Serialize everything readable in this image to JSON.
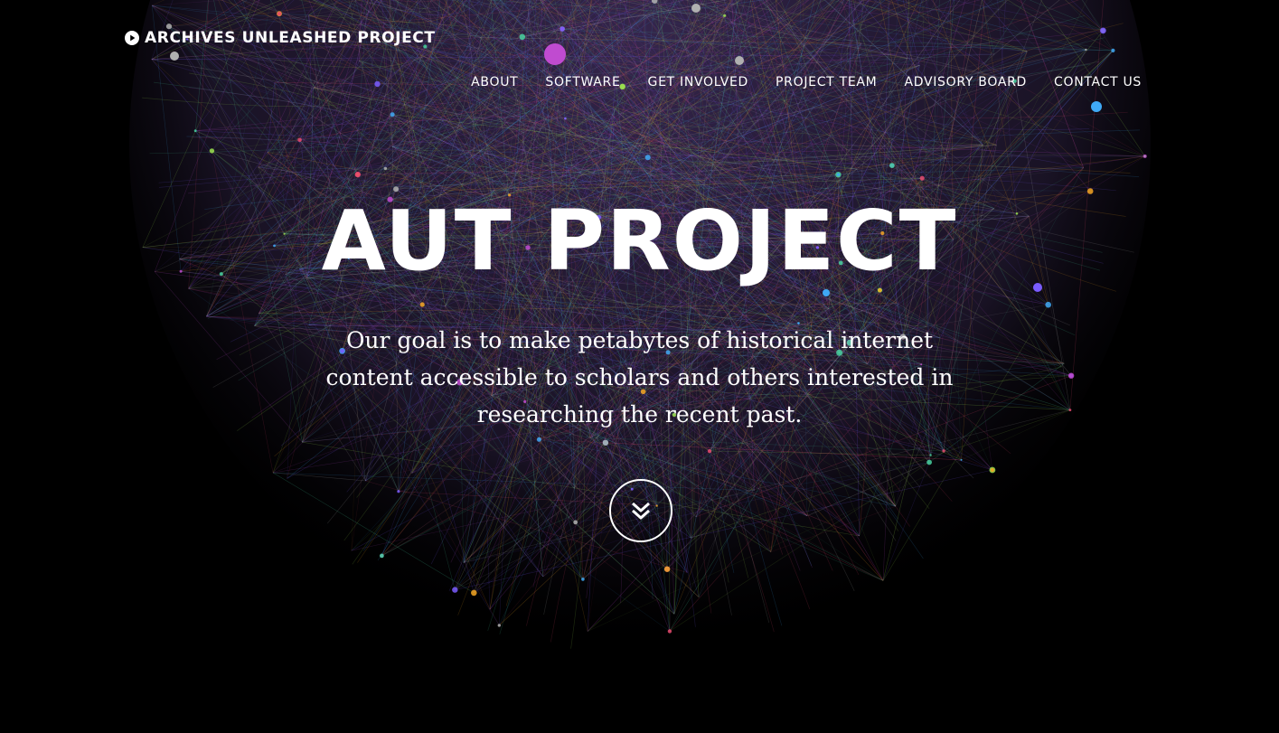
{
  "brand": {
    "title": "ARCHIVES UNLEASHED PROJECT",
    "icon": "play-circle-icon"
  },
  "nav": {
    "items": [
      {
        "label": "ABOUT"
      },
      {
        "label": "SOFTWARE"
      },
      {
        "label": "GET INVOLVED"
      },
      {
        "label": "PROJECT TEAM"
      },
      {
        "label": "ADVISORY BOARD"
      },
      {
        "label": "CONTACT US"
      }
    ]
  },
  "hero": {
    "title": "AUT PROJECT",
    "description": "Our goal is to make petabytes of historical internet content accessible to scholars and others interested in researching the recent past.",
    "scroll_icon": "double-chevron-down-icon"
  },
  "colors": {
    "background": "#000000",
    "text": "#ffffff",
    "network_palette": [
      "#c04bd0",
      "#7a5cff",
      "#3fa9f5",
      "#48d1a0",
      "#f5a623",
      "#e84a6f",
      "#9be04f",
      "#b0b0b0"
    ]
  }
}
